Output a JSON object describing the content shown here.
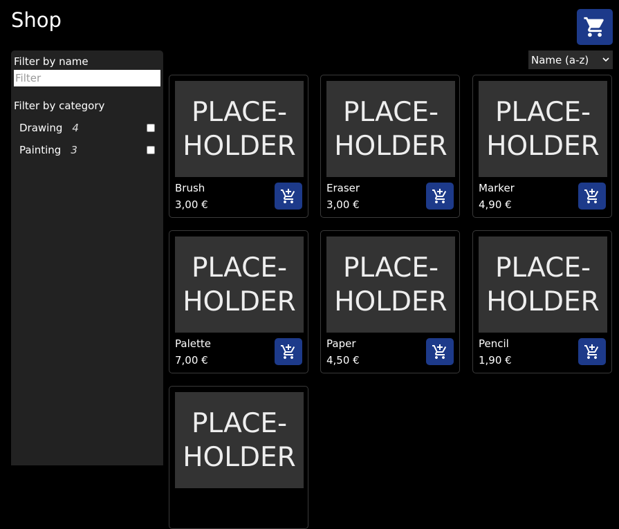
{
  "header": {
    "title": "Shop",
    "cart_icon": "cart-icon"
  },
  "sidebar": {
    "name_filter_label": "Filter by name",
    "name_filter_placeholder": "Filter",
    "category_filter_label": "Filter by category",
    "categories": [
      {
        "label": "Drawing",
        "count": "4",
        "checked": false
      },
      {
        "label": "Painting",
        "count": "3",
        "checked": false
      }
    ]
  },
  "sort": {
    "selected": "Name (a-z)"
  },
  "placeholder_text": "PLACE-\nHOLDER",
  "products": [
    {
      "name": "Brush",
      "price": "3,00 €"
    },
    {
      "name": "Eraser",
      "price": "3,00 €"
    },
    {
      "name": "Marker",
      "price": "4,90 €"
    },
    {
      "name": "Palette",
      "price": "7,00 €"
    },
    {
      "name": "Paper",
      "price": "4,50 €"
    },
    {
      "name": "Pencil",
      "price": "1,90 €"
    },
    {
      "name": "",
      "price": ""
    }
  ],
  "colors": {
    "accent": "#1d3a8a",
    "panel": "#222222",
    "thumb": "#333333"
  }
}
